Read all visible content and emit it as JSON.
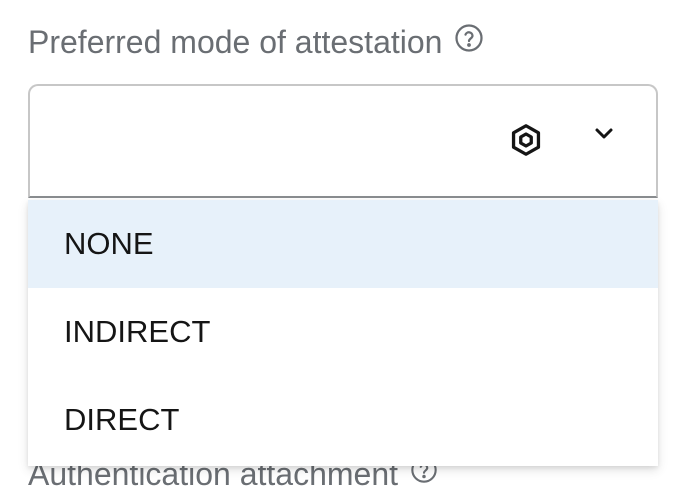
{
  "attestation_field": {
    "label": "Preferred mode of attestation",
    "help_icon": "question-circle-icon",
    "selected_value": "",
    "type_icon": "cube-icon",
    "toggle_icon": "chevron-down-icon"
  },
  "dropdown": {
    "items": [
      {
        "label": "NONE",
        "highlighted": true
      },
      {
        "label": "INDIRECT",
        "highlighted": false
      },
      {
        "label": "DIRECT",
        "highlighted": false
      }
    ]
  },
  "next_field": {
    "label": "Authentication attachment",
    "help_icon": "question-circle-icon"
  },
  "colors": {
    "label_text": "#6a6e73",
    "highlight": "#e7f1fa",
    "item_text": "#151515",
    "border": "#c7c7c7"
  }
}
